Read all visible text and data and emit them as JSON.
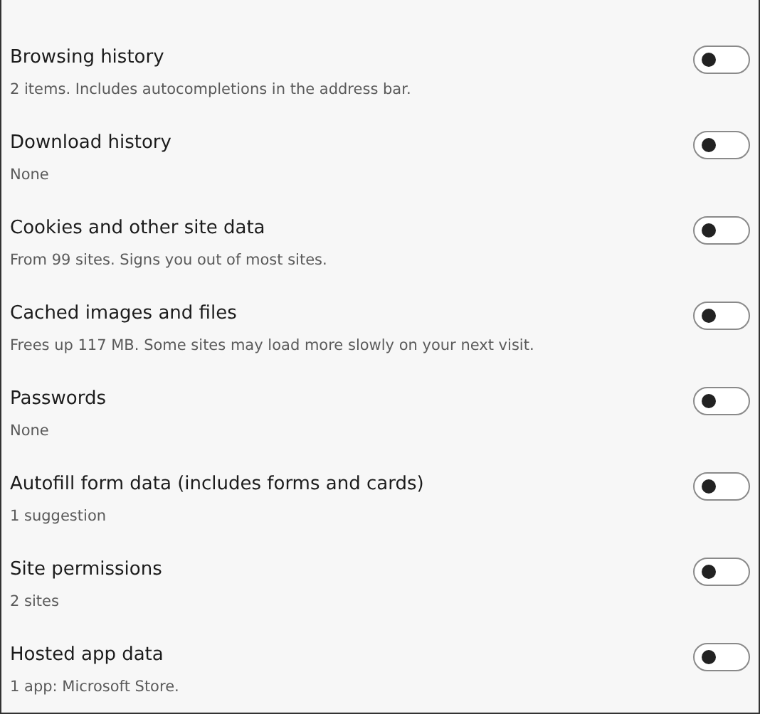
{
  "options": [
    {
      "title": "Browsing history",
      "description": "2 items. Includes autocompletions in the address bar.",
      "on": false
    },
    {
      "title": "Download history",
      "description": "None",
      "on": false
    },
    {
      "title": "Cookies and other site data",
      "description": "From 99 sites. Signs you out of most sites.",
      "on": false
    },
    {
      "title": "Cached images and files",
      "description": "Frees up 117 MB. Some sites may load more slowly on your next visit.",
      "on": false
    },
    {
      "title": "Passwords",
      "description": "None",
      "on": false
    },
    {
      "title": "Autofill form data (includes forms and cards)",
      "description": "1 suggestion",
      "on": false
    },
    {
      "title": "Site permissions",
      "description": "2 sites",
      "on": false
    },
    {
      "title": "Hosted app data",
      "description": "1 app: Microsoft Store.",
      "on": false
    }
  ]
}
